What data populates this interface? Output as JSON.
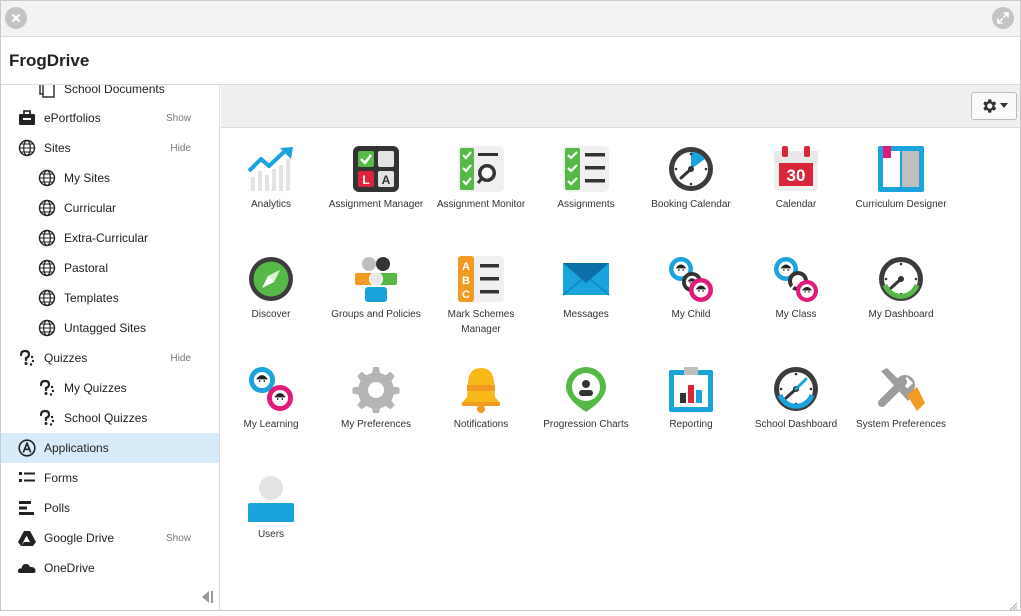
{
  "window": {
    "title": "FrogDrive",
    "close_icon": "close-icon",
    "expand_icon": "expand-icon"
  },
  "sidebar": {
    "items": [
      {
        "label": "School Documents",
        "icon": "documents-icon",
        "level": 1
      },
      {
        "label": "ePortfolios",
        "icon": "briefcase-icon",
        "level": 0,
        "toggle": "Show"
      },
      {
        "label": "Sites",
        "icon": "globe-icon",
        "level": 0,
        "toggle": "Hide"
      },
      {
        "label": "My Sites",
        "icon": "globe-icon",
        "level": 1
      },
      {
        "label": "Curricular",
        "icon": "globe-icon",
        "level": 1
      },
      {
        "label": "Extra-Curricular",
        "icon": "globe-icon",
        "level": 1
      },
      {
        "label": "Pastoral",
        "icon": "globe-icon",
        "level": 1
      },
      {
        "label": "Templates",
        "icon": "globe-icon",
        "level": 1
      },
      {
        "label": "Untagged Sites",
        "icon": "globe-icon",
        "level": 1
      },
      {
        "label": "Quizzes",
        "icon": "quiz-icon",
        "level": 0,
        "toggle": "Hide"
      },
      {
        "label": "My Quizzes",
        "icon": "quiz-icon",
        "level": 1
      },
      {
        "label": "School Quizzes",
        "icon": "quiz-icon",
        "level": 1
      },
      {
        "label": "Applications",
        "icon": "applications-icon",
        "level": 0,
        "active": true
      },
      {
        "label": "Forms",
        "icon": "forms-icon",
        "level": 0
      },
      {
        "label": "Polls",
        "icon": "polls-icon",
        "level": 0
      },
      {
        "label": "Google Drive",
        "icon": "google-drive-icon",
        "level": 0,
        "toggle": "Show"
      },
      {
        "label": "OneDrive",
        "icon": "onedrive-icon",
        "level": 0
      }
    ],
    "collapse_icon": "collapse-sidebar-icon"
  },
  "toolbar": {
    "settings_icon": "gear-icon",
    "dropdown_icon": "caret-down-icon"
  },
  "apps": [
    {
      "name": "Analytics",
      "icon": "analytics"
    },
    {
      "name": "Assignment Manager",
      "icon": "assignment-manager"
    },
    {
      "name": "Assignment Monitor",
      "icon": "assignment-monitor"
    },
    {
      "name": "Assignments",
      "icon": "assignments"
    },
    {
      "name": "Booking Calendar",
      "icon": "booking-calendar"
    },
    {
      "name": "Calendar",
      "icon": "calendar",
      "badge": "30"
    },
    {
      "name": "Curriculum Designer",
      "icon": "curriculum-designer"
    },
    {
      "name": "Discover",
      "icon": "discover"
    },
    {
      "name": "Groups and Policies",
      "icon": "groups-policies"
    },
    {
      "name": "Mark Schemes Manager",
      "icon": "mark-schemes",
      "letters": [
        "A",
        "B",
        "C"
      ]
    },
    {
      "name": "Messages",
      "icon": "messages"
    },
    {
      "name": "My Child",
      "icon": "my-child"
    },
    {
      "name": "My Class",
      "icon": "my-class"
    },
    {
      "name": "My Dashboard",
      "icon": "my-dashboard"
    },
    {
      "name": "My Learning",
      "icon": "my-learning"
    },
    {
      "name": "My Preferences",
      "icon": "my-preferences"
    },
    {
      "name": "Notifications",
      "icon": "notifications"
    },
    {
      "name": "Progression Charts",
      "icon": "progression-charts"
    },
    {
      "name": "Reporting",
      "icon": "reporting"
    },
    {
      "name": "School Dashboard",
      "icon": "school-dashboard"
    },
    {
      "name": "System Preferences",
      "icon": "system-preferences"
    },
    {
      "name": "Users",
      "icon": "users"
    }
  ],
  "colors": {
    "active_bg": "#d7ecf8",
    "blue": "#1aa3dc",
    "green": "#56b947",
    "red": "#d9263b",
    "dark": "#3c3c3c",
    "orange": "#f39a22",
    "pink": "#e3197b",
    "yellow": "#f7b91a"
  }
}
